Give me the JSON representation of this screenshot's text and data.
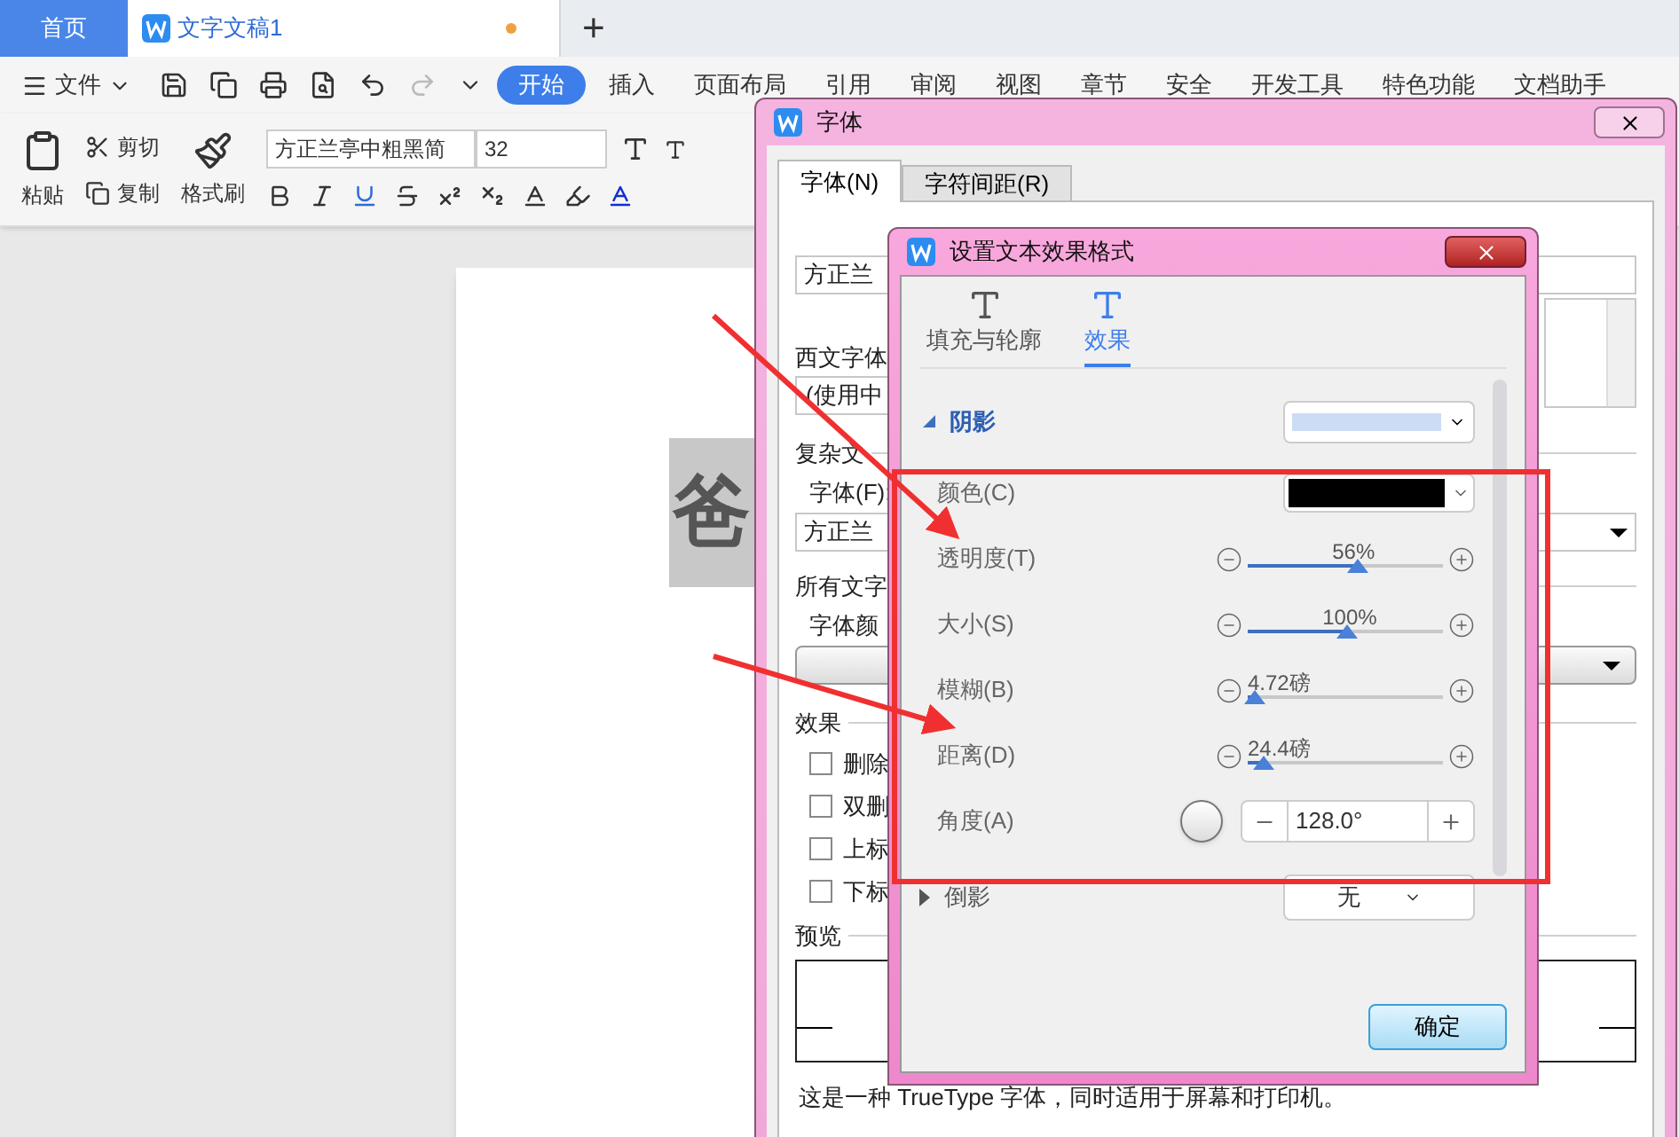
{
  "tabs": [
    {
      "label": "首页",
      "selected": false,
      "modified": false
    },
    {
      "label": "文字文稿1",
      "selected": true,
      "modified": true
    }
  ],
  "new_tab": "+",
  "menu": {
    "file": "文件",
    "tabs": [
      {
        "label": "开始",
        "selected": true
      },
      {
        "label": "插入",
        "selected": false
      },
      {
        "label": "页面布局",
        "selected": false
      },
      {
        "label": "引用",
        "selected": false
      },
      {
        "label": "审阅",
        "selected": false
      },
      {
        "label": "视图",
        "selected": false
      },
      {
        "label": "章节",
        "selected": false
      },
      {
        "label": "安全",
        "selected": false
      },
      {
        "label": "开发工具",
        "selected": false
      },
      {
        "label": "特色功能",
        "selected": false
      },
      {
        "label": "文档助手",
        "selected": false
      }
    ]
  },
  "toolbar": {
    "paste": "粘贴",
    "cut": "剪切",
    "copy": "复制",
    "format_painter": "格式刷",
    "font_name": "方正兰亭中粗黑简",
    "font_size": "32"
  },
  "document": {
    "selected_text": "爸"
  },
  "font_dialog": {
    "title": "字体",
    "tabs": [
      {
        "label": "字体(N)",
        "selected": true
      },
      {
        "label": "字符间距(R)",
        "selected": false
      }
    ],
    "chinese_font_value": "方正兰",
    "western_font_label": "西文字体",
    "western_font_value": "(使用中",
    "complex_heading": "复杂文",
    "complex_font_label": "字体(F):",
    "complex_font_value": "方正兰",
    "all_text_heading": "所有文字",
    "font_color_label": "字体颜",
    "effects_heading": "效果",
    "effects": [
      {
        "label": "删除",
        "checked": false
      },
      {
        "label": "双删",
        "checked": false
      },
      {
        "label": "上标",
        "checked": false
      },
      {
        "label": "下标",
        "checked": false
      }
    ],
    "preview_heading": "预览",
    "description": "这是一种 TrueType 字体，同时适用于屏幕和打印机。"
  },
  "effect_dialog": {
    "title": "设置文本效果格式",
    "tabs": [
      {
        "label": "填充与轮廓",
        "selected": false
      },
      {
        "label": "效果",
        "selected": true
      }
    ],
    "shadow": {
      "label": "阴影",
      "expanded": true
    },
    "rows": [
      {
        "kind": "color",
        "label": "颜色(C)",
        "color": "#000000"
      },
      {
        "kind": "slider",
        "label": "透明度(T)",
        "reading": "56%",
        "level": 0.56
      },
      {
        "kind": "slider",
        "label": "大小(S)",
        "reading": "100%",
        "level": 0.51
      },
      {
        "kind": "slider",
        "label": "模糊(B)",
        "reading": "4.72磅",
        "level": 0.04
      },
      {
        "kind": "slider",
        "label": "距离(D)",
        "reading": "24.4磅",
        "level": 0.08
      },
      {
        "kind": "angle",
        "label": "角度(A)",
        "value": "128.0°"
      }
    ],
    "reflection": {
      "label": "倒影",
      "expanded": false,
      "value": "无"
    },
    "ok": "确定"
  }
}
